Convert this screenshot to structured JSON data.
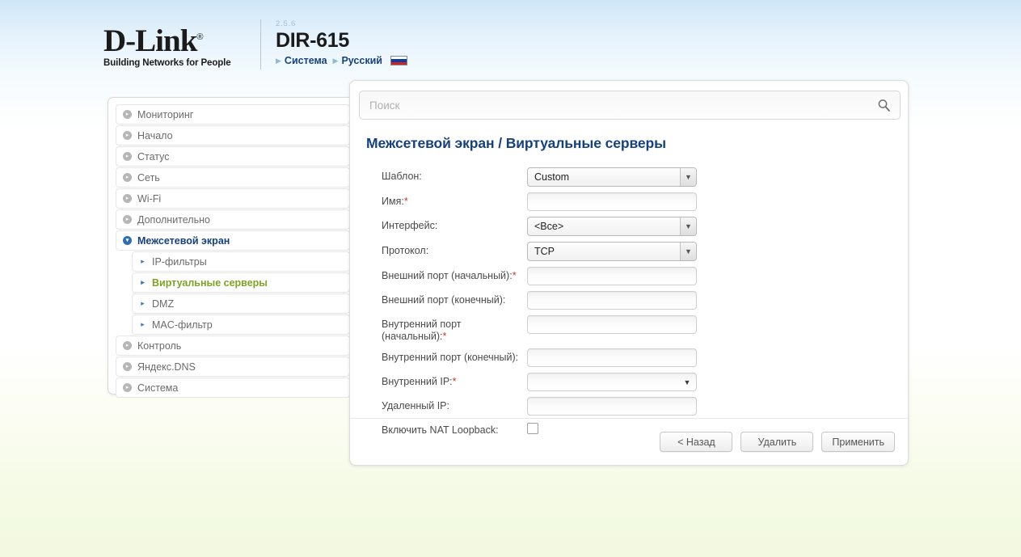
{
  "header": {
    "logo_name": "D-Link",
    "logo_reg": "®",
    "logo_tagline": "Building Networks for People",
    "firmware_version": "2.5.6",
    "model": "DIR-615",
    "nav": [
      {
        "label": "Система"
      },
      {
        "label": "Русский"
      }
    ],
    "flag": "russian-flag"
  },
  "sidebar": {
    "items": [
      {
        "label": "Мониторинг",
        "level": 0,
        "state": "normal",
        "icon": "chevron-circle-icon"
      },
      {
        "label": "Начало",
        "level": 0,
        "state": "normal",
        "icon": "chevron-circle-icon"
      },
      {
        "label": "Статус",
        "level": 0,
        "state": "normal",
        "icon": "chevron-circle-icon"
      },
      {
        "label": "Сеть",
        "level": 0,
        "state": "normal",
        "icon": "chevron-circle-icon"
      },
      {
        "label": "Wi-Fi",
        "level": 0,
        "state": "normal",
        "icon": "chevron-circle-icon"
      },
      {
        "label": "Дополнительно",
        "level": 0,
        "state": "normal",
        "icon": "chevron-circle-icon"
      },
      {
        "label": "Межсетевой экран",
        "level": 0,
        "state": "expanded",
        "icon": "chevron-circle-icon"
      },
      {
        "label": "IP-фильтры",
        "level": 1,
        "state": "normal",
        "icon": "triangle-right-icon"
      },
      {
        "label": "Виртуальные серверы",
        "level": 1,
        "state": "selected",
        "icon": "triangle-right-icon"
      },
      {
        "label": "DMZ",
        "level": 1,
        "state": "normal",
        "icon": "triangle-right-icon"
      },
      {
        "label": "MAC-фильтр",
        "level": 1,
        "state": "normal",
        "icon": "triangle-right-icon"
      },
      {
        "label": "Контроль",
        "level": 0,
        "state": "normal",
        "icon": "chevron-circle-icon"
      },
      {
        "label": "Яндекс.DNS",
        "level": 0,
        "state": "normal",
        "icon": "chevron-circle-icon"
      },
      {
        "label": "Система",
        "level": 0,
        "state": "normal",
        "icon": "chevron-circle-icon"
      }
    ]
  },
  "search": {
    "placeholder": "Поиск",
    "value": "",
    "icon": "search-icon"
  },
  "main": {
    "title_part1": "Межсетевой экран / ",
    "title_part2": "Виртуальные серверы",
    "fields": {
      "template": {
        "label": "Шаблон:",
        "value": "Custom",
        "type": "select"
      },
      "name": {
        "label": "Имя:",
        "required": "*",
        "value": "",
        "type": "text"
      },
      "interface": {
        "label": "Интерфейс:",
        "value": "<Все>",
        "type": "select"
      },
      "protocol": {
        "label": "Протокол:",
        "value": "TCP",
        "type": "select"
      },
      "ext_port_start": {
        "label": "Внешний порт (начальный):",
        "required": "*",
        "value": "",
        "type": "text"
      },
      "ext_port_end": {
        "label": "Внешний порт (конечный):",
        "value": "",
        "type": "text"
      },
      "int_port_start": {
        "label": "Внутренний порт (начальный):",
        "required": "*",
        "value": "",
        "type": "text"
      },
      "int_port_end": {
        "label": "Внутренний порт (конечный):",
        "value": "",
        "type": "text"
      },
      "internal_ip": {
        "label": "Внутренний IP:",
        "required": "*",
        "value": "",
        "type": "combo"
      },
      "remote_ip": {
        "label": "Удаленный IP:",
        "value": "",
        "type": "text"
      },
      "nat_loopback": {
        "label": "Включить NAT Loopback:",
        "checked": false,
        "type": "checkbox"
      }
    },
    "buttons": {
      "back": "< Назад",
      "delete": "Удалить",
      "apply": "Применить"
    }
  },
  "colors": {
    "brand_blue": "#15417e",
    "selected_green": "#7fa226",
    "required_red": "#c0392b"
  }
}
